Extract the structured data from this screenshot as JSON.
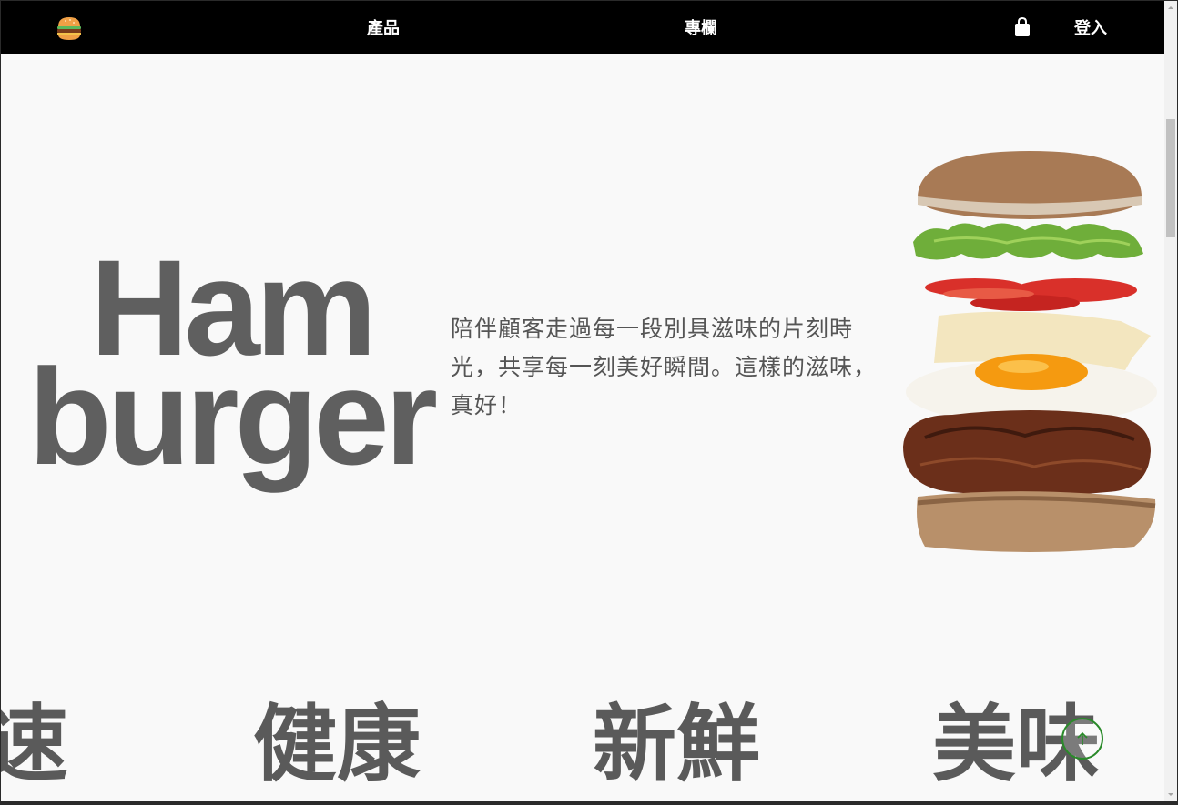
{
  "nav": {
    "logo_icon": "hamburger-logo-icon",
    "products_label": "產品",
    "column_label": "專欄",
    "cart_icon": "shopping-bag-icon",
    "login_label": "登入"
  },
  "hero": {
    "title_line1": "Ham",
    "title_line2": "burger",
    "description": "陪伴顧客走過每一段別具滋味的片刻時光，共享每一刻美好瞬間。這樣的滋味，真好！",
    "image": "exploded-hamburger-image"
  },
  "marquee": {
    "words": [
      "速",
      "健康",
      "新鮮",
      "美味"
    ]
  },
  "back_to_top": {
    "icon": "arrow-up-icon"
  },
  "colors": {
    "navbar_bg": "#000000",
    "page_bg": "#f9f9f9",
    "title_gray": "#5f5f5f",
    "back_top_border": "#2a8a2a"
  }
}
